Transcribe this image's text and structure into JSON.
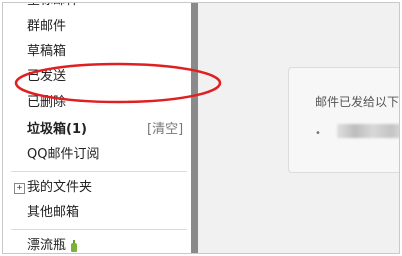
{
  "sidebar": {
    "clipped_top_label": "星标邮件",
    "items": [
      {
        "label": "群邮件"
      },
      {
        "label": "草稿箱"
      },
      {
        "label": "已发送"
      },
      {
        "label": "已删除"
      },
      {
        "label": "垃圾箱(1)"
      },
      {
        "label": "QQ邮件订阅"
      }
    ],
    "clear_link": "[清空]",
    "folders": {
      "expand_symbol": "+",
      "label": "我的文件夹"
    },
    "other_mailbox": "其他邮箱",
    "drift_bottle": "漂流瓶"
  },
  "main": {
    "notice_text": "邮件已发给以下",
    "bullet": "•"
  },
  "colors": {
    "annotation": "#e02020",
    "splitter": "#8a8a8a",
    "bottle": "#7ab23a"
  },
  "icons": [
    "expand-icon",
    "bottle-icon"
  ]
}
